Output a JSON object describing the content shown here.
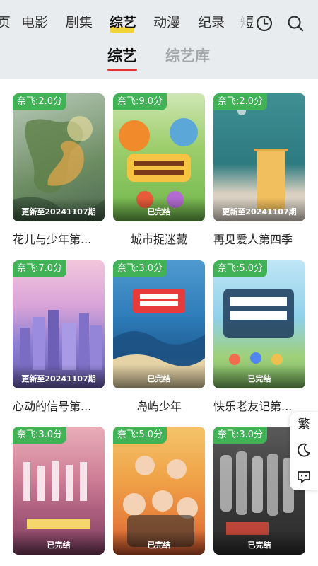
{
  "nav": {
    "tabs": [
      {
        "label": "页",
        "active": false
      },
      {
        "label": "电影",
        "active": false
      },
      {
        "label": "剧集",
        "active": false
      },
      {
        "label": "综艺",
        "active": true
      },
      {
        "label": "动漫",
        "active": false
      },
      {
        "label": "纪录",
        "active": false
      },
      {
        "label": "短",
        "active": false
      }
    ],
    "history_icon": "clock-icon",
    "search_icon": "search-icon"
  },
  "subtabs": [
    {
      "label": "综艺",
      "active": true
    },
    {
      "label": "综艺库",
      "active": false
    }
  ],
  "cards": [
    {
      "badge": "奈飞:2.0分",
      "status": "更新至20241107期",
      "title": "花儿与少年第..."
    },
    {
      "badge": "奈飞:9.0分",
      "status": "已完结",
      "title": "城市捉迷藏"
    },
    {
      "badge": "奈飞:2.0分",
      "status": "更新至20241107期",
      "title": "再见爱人第四季"
    },
    {
      "badge": "奈飞:7.0分",
      "status": "更新至20241107期",
      "title": "心动的信号第..."
    },
    {
      "badge": "奈飞:3.0分",
      "status": "已完结",
      "title": "岛屿少年"
    },
    {
      "badge": "奈飞:5.0分",
      "status": "已完结",
      "title": "快乐老友记第..."
    },
    {
      "badge": "奈飞:3.0分",
      "status": "已完结",
      "title": ""
    },
    {
      "badge": "奈飞:5.0分",
      "status": "已完结",
      "title": ""
    },
    {
      "badge": "奈飞:3.0分",
      "status": "已完结",
      "title": ""
    }
  ],
  "side_tools": {
    "traditional_label": "繁",
    "theme_icon": "moon-icon",
    "feedback_icon": "chat-icon"
  },
  "colors": {
    "badge_green": "#41b256",
    "accent_red": "#e23434",
    "nav_highlight": "#f4d23a",
    "header_bg": "#e9ecee"
  }
}
